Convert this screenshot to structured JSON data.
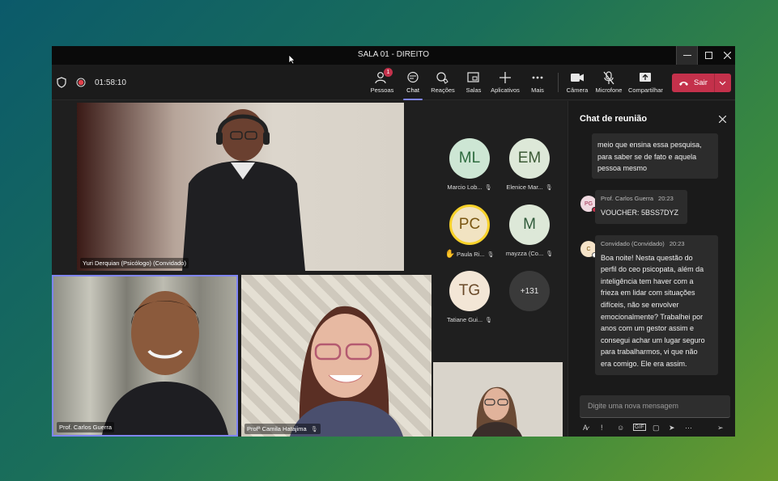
{
  "window": {
    "title": "SALA 01 - DIREITO"
  },
  "toolbar": {
    "timer": "01:58:10",
    "people": {
      "label": "Pessoas",
      "badge": "1"
    },
    "chat": {
      "label": "Chat"
    },
    "reactions": {
      "label": "Reações"
    },
    "rooms": {
      "label": "Salas"
    },
    "apps": {
      "label": "Aplicativos"
    },
    "more": {
      "label": "Mais"
    },
    "camera": {
      "label": "Câmera"
    },
    "microphone": {
      "label": "Microfone"
    },
    "share": {
      "label": "Compartilhar"
    },
    "leave": {
      "label": "Sair"
    }
  },
  "stage": {
    "main_video": {
      "name": "Yuri Derquian (Psicólogo) (Convidado)"
    },
    "video2": {
      "name": "Prof. Carlos Guerra"
    },
    "video3": {
      "name": "Profª Camila Hatajima"
    },
    "gallery": [
      {
        "initials": "ML",
        "name": "Marcio Lob...",
        "muted": true
      },
      {
        "initials": "EM",
        "name": "Elenice Mar...",
        "muted": true
      },
      {
        "initials": "PC",
        "name": "Paula Ri...",
        "muted": true,
        "hand_raised": true
      },
      {
        "initials": "M",
        "name": "mayzza (Co...",
        "muted": true
      },
      {
        "initials": "TG",
        "name": "Tatiane Gui...",
        "muted": true
      }
    ],
    "overflow": "+131"
  },
  "chat": {
    "title": "Chat de reunião",
    "messages": [
      {
        "text_lines": [
          "meio que ensina essa pesquisa,",
          "para saber se de fato e aquela",
          "pessoa mesmo"
        ]
      },
      {
        "initials": "PG",
        "author": "Prof. Carlos Guerra",
        "time": "20:23",
        "text_lines": [
          "VOUCHER: 5BSS7DYZ"
        ]
      },
      {
        "initials": "C",
        "author": "Convidado (Convidado)",
        "time": "20:23",
        "text_lines": [
          "Boa noite! Nesta questão do",
          "perfil do ceo psicopata, além da",
          "inteligência tem haver com a",
          "frieza em lidar com situações",
          "difíceis, não se envolver",
          "emocionalmente? Trabalhei por",
          "anos com um gestor assim e",
          "consegui achar um lugar seguro",
          "para trabalharmos, vi que não",
          "era comigo. Ele era assim."
        ]
      }
    ],
    "composer_placeholder": "Digite uma nova mensagem"
  },
  "colors": {
    "accent": "#7f85f5",
    "leave": "#c4314b",
    "hand": "#f8d22a"
  }
}
